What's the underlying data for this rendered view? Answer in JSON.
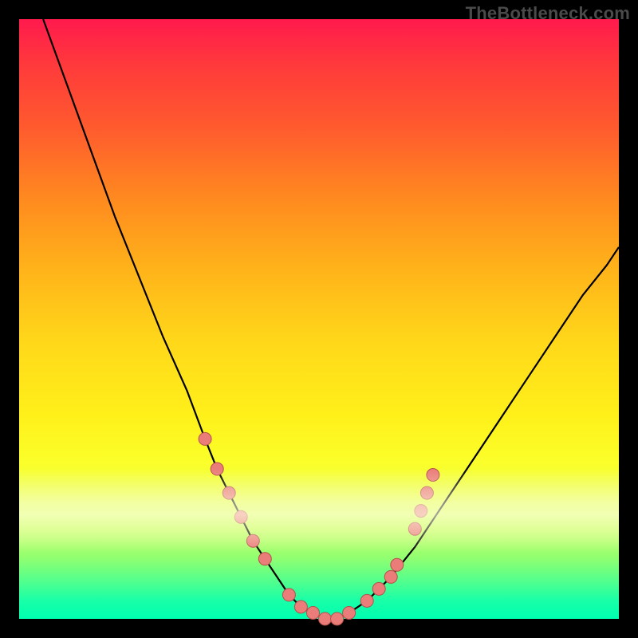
{
  "watermark": "TheBottleneck.com",
  "colors": {
    "curve": "#000000",
    "marker_fill": "#ea7d7a",
    "marker_stroke": "#b64f4a"
  },
  "chart_data": {
    "type": "line",
    "title": "",
    "xlabel": "",
    "ylabel": "",
    "xlim": [
      0,
      100
    ],
    "ylim": [
      0,
      100
    ],
    "grid": false,
    "series": [
      {
        "name": "bottleneck-curve",
        "x": [
          4,
          8,
          12,
          16,
          20,
          24,
          28,
          31,
          33,
          35,
          37,
          39,
          41,
          43,
          45,
          47,
          49,
          51,
          53,
          55,
          58,
          62,
          66,
          70,
          74,
          78,
          82,
          86,
          90,
          94,
          98,
          100
        ],
        "y": [
          100,
          89,
          78,
          67,
          57,
          47,
          38,
          30,
          25,
          21,
          17,
          13,
          10,
          7,
          4,
          2,
          1,
          0,
          0,
          1,
          3,
          7,
          12,
          18,
          24,
          30,
          36,
          42,
          48,
          54,
          59,
          62
        ]
      }
    ],
    "markers": {
      "name": "highlighted-points",
      "points": [
        {
          "x": 31,
          "y": 30
        },
        {
          "x": 33,
          "y": 25
        },
        {
          "x": 35,
          "y": 21
        },
        {
          "x": 37,
          "y": 17
        },
        {
          "x": 39,
          "y": 13
        },
        {
          "x": 41,
          "y": 10
        },
        {
          "x": 45,
          "y": 4
        },
        {
          "x": 47,
          "y": 2
        },
        {
          "x": 49,
          "y": 1
        },
        {
          "x": 51,
          "y": 0
        },
        {
          "x": 53,
          "y": 0
        },
        {
          "x": 55,
          "y": 1
        },
        {
          "x": 58,
          "y": 3
        },
        {
          "x": 60,
          "y": 5
        },
        {
          "x": 62,
          "y": 7
        },
        {
          "x": 63,
          "y": 9
        },
        {
          "x": 66,
          "y": 15
        },
        {
          "x": 67,
          "y": 18
        },
        {
          "x": 68,
          "y": 21
        },
        {
          "x": 69,
          "y": 24
        }
      ]
    }
  }
}
